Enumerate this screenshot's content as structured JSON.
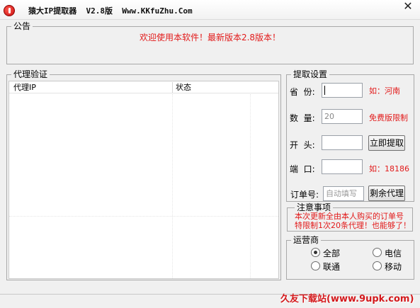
{
  "window": {
    "title": "猿大IP提取器  V2.8版  Www.KKfuZhu.Com",
    "close_symbol": "✕"
  },
  "notice": {
    "legend": "公告",
    "text": "欢迎使用本软件！最新版本2.8版本！"
  },
  "verify": {
    "legend": "代理验证",
    "columns": [
      "代理IP",
      "状态"
    ]
  },
  "fetch": {
    "legend": "提取设置",
    "province_label": "省  份:",
    "province_value": "",
    "province_hint": "如：河南",
    "quantity_label": "数  量:",
    "quantity_value": "20",
    "quantity_hint": "免费版限制",
    "prefix_label": "开  头:",
    "prefix_value": "",
    "fetch_button": "立即提取",
    "port_label": "端  口:",
    "port_value": "",
    "port_hint": "如：18186",
    "order_label": "订单号:",
    "order_placeholder": "自动填写",
    "remaining_button": "剩余代理"
  },
  "attention": {
    "legend": "注意事项",
    "line1": "本次更新全由本人购买的订单号",
    "line2": "特限制1次20条代理！也能够了！"
  },
  "carrier": {
    "legend": "运营商",
    "options": [
      {
        "label": "全部",
        "selected": true
      },
      {
        "label": "电信",
        "selected": false
      },
      {
        "label": "联通",
        "selected": false
      },
      {
        "label": "移动",
        "selected": false
      }
    ]
  },
  "watermark": "久友下载站(www.9upk.com)"
}
